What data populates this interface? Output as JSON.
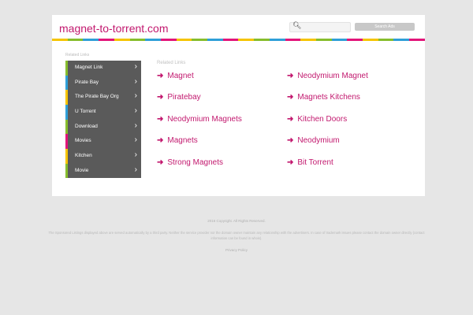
{
  "header": {
    "domain": "magnet-to-torrent.com",
    "search_icon": "search-icon",
    "search_button_label": "Search Ads"
  },
  "stripe_colors": [
    "#f5c400",
    "#86bd2d",
    "#2f9fd8",
    "#e2157a",
    "#f5c400",
    "#86bd2d",
    "#2f9fd8",
    "#e2157a",
    "#f5c400",
    "#86bd2d",
    "#2f9fd8",
    "#e2157a",
    "#f5c400",
    "#86bd2d",
    "#2f9fd8",
    "#e2157a",
    "#f5c400",
    "#86bd2d",
    "#2f9fd8",
    "#e2157a",
    "#f5c400",
    "#86bd2d",
    "#2f9fd8",
    "#e2157a"
  ],
  "sidebar": {
    "heading": "Related Links",
    "items": [
      {
        "label": "Magnet Link",
        "accent": "#86bd2d"
      },
      {
        "label": "Pirate Bay",
        "accent": "#2f9fd8"
      },
      {
        "label": "The Pirate Bay Org",
        "accent": "#f5c400"
      },
      {
        "label": "U Torrent",
        "accent": "#2f9fd8"
      },
      {
        "label": "Download",
        "accent": "#86bd2d"
      },
      {
        "label": "Movies",
        "accent": "#e2157a"
      },
      {
        "label": "Kitchen",
        "accent": "#f5c400"
      },
      {
        "label": "Movie",
        "accent": "#86bd2d"
      }
    ]
  },
  "related": {
    "heading": "Related Links",
    "left": [
      "Magnet",
      "Piratebay",
      "Neodymium Magnets",
      "Magnets",
      "Strong Magnets"
    ],
    "right": [
      "Neodymium Magnet",
      "Magnets Kitchens",
      "Kitchen Doors",
      "Neodymium",
      "Bit Torrent"
    ]
  },
  "footer": {
    "copyright": "2016 Copyright. All Rights Reserved.",
    "disclaimer": "The Sponsored Listings displayed above are served automatically by a third party. Neither the service provider nor the domain owner maintain any relationship with the advertisers. In case of trademark issues please contact the domain owner directly (contact information can be found in whois).",
    "privacy": "Privacy Policy"
  }
}
